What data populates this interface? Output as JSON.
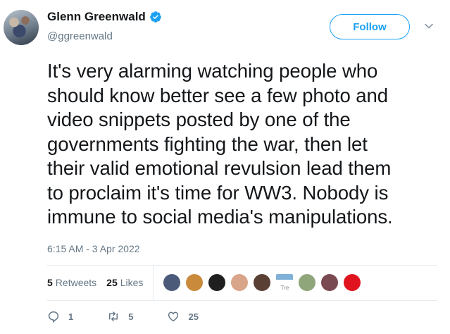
{
  "author": {
    "display_name": "Glenn Greenwald",
    "handle": "@ggreenwald",
    "verified": true
  },
  "follow_label": "Follow",
  "tweet": {
    "lines": [
      "It's very alarming watching people who",
      "should know better see a few photo and",
      "video snippets posted by one of the",
      "governments fighting the war, then let",
      "their valid emotional revulsion lead them",
      "to proclaim it's time for WW3. Nobody is",
      "immune to social media's manipulations."
    ],
    "timestamp": "6:15 AM - 3 Apr 2022"
  },
  "stats": {
    "retweets_count": "5",
    "retweets_label": "Retweets",
    "likes_count": "25",
    "likes_label": "Likes"
  },
  "likers": [
    {
      "color": "#4a5a78"
    },
    {
      "color": "#c98a3c"
    },
    {
      "color": "#1f1f1f"
    },
    {
      "color": "#d9a58a"
    },
    {
      "color": "#5a3f35"
    },
    {
      "color": "#7fb0d8",
      "alt_text": "Tre"
    },
    {
      "color": "#8fa57a"
    },
    {
      "color": "#7a4a52"
    },
    {
      "color": "#e0141e"
    }
  ],
  "actions": {
    "replies": "1",
    "retweets": "5",
    "likes": "25"
  },
  "colors": {
    "accent": "#1da1f2",
    "secondary_text": "#657786",
    "divider": "#e6ecf0"
  }
}
